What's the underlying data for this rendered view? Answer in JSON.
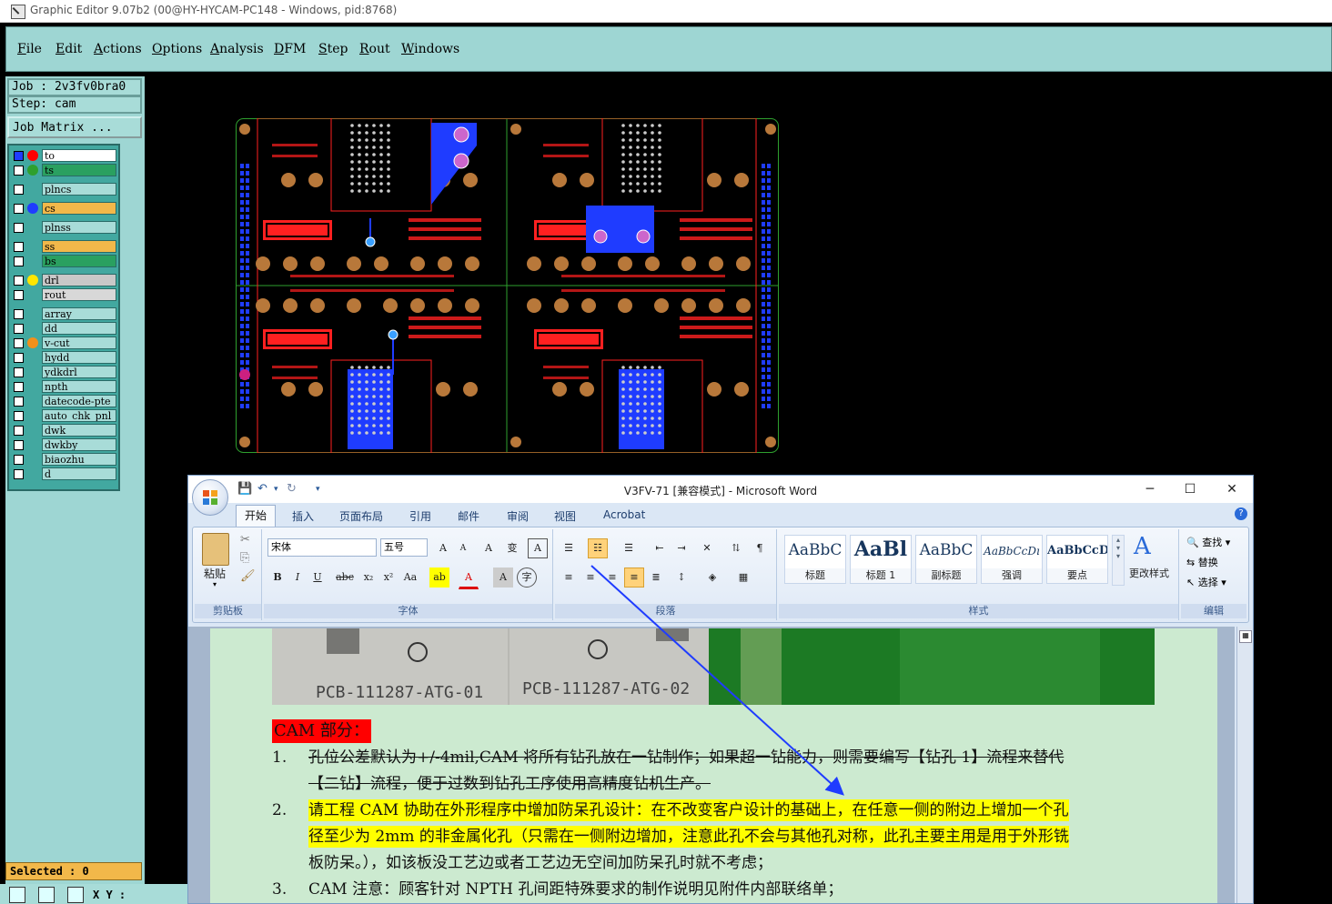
{
  "graphic_editor": {
    "title": "Graphic Editor 9.07b2 (00@HY-HYCAM-PC148 - Windows, pid:8768)",
    "menu": [
      "File",
      "Edit",
      "Actions",
      "Options",
      "Analysis",
      "DFM",
      "Step",
      "Rout",
      "Windows"
    ],
    "job_label": "Job : 2v3fv0bra0",
    "step_label": "Step: cam",
    "job_matrix_label": "Job Matrix ...",
    "layers": [
      {
        "name": "to",
        "color": "#ff0000",
        "checked": true,
        "highlight": "#ffffff"
      },
      {
        "name": "ts",
        "color": "#2ea02e",
        "checked": false,
        "highlight": "#2aa060"
      },
      {
        "name": "plncs",
        "color": "",
        "checked": false,
        "highlight": "#a8dcd8"
      },
      {
        "name": "cs",
        "color": "#1f3cff",
        "checked": false,
        "highlight": "#f2b84a"
      },
      {
        "name": "plnss",
        "color": "",
        "checked": false,
        "highlight": "#a8dcd8"
      },
      {
        "name": "ss",
        "color": "",
        "checked": false,
        "highlight": "#f2b84a"
      },
      {
        "name": "bs",
        "color": "",
        "checked": false,
        "highlight": "#2aa060"
      },
      {
        "name": "drl",
        "color": "#ffe600",
        "checked": false,
        "highlight": "#c8c8c8"
      },
      {
        "name": "rout",
        "color": "",
        "checked": false,
        "highlight": "#d8d8d8"
      },
      {
        "name": "array",
        "color": "",
        "checked": false,
        "highlight": "#a8dcd8"
      },
      {
        "name": "dd",
        "color": "",
        "checked": false,
        "highlight": "#a8dcd8"
      },
      {
        "name": "v-cut",
        "color": "#f2901a",
        "checked": false,
        "highlight": "#a8dcd8"
      },
      {
        "name": "hydd",
        "color": "",
        "checked": false,
        "highlight": "#a8dcd8"
      },
      {
        "name": "ydkdrl",
        "color": "",
        "checked": false,
        "highlight": "#a8dcd8"
      },
      {
        "name": "npth",
        "color": "",
        "checked": false,
        "highlight": "#a8dcd8"
      },
      {
        "name": "datecode-pte",
        "color": "",
        "checked": false,
        "highlight": "#a8dcd8"
      },
      {
        "name": "auto_chk_pnl",
        "color": "",
        "checked": false,
        "highlight": "#a8dcd8"
      },
      {
        "name": "dwk",
        "color": "",
        "checked": false,
        "highlight": "#a8dcd8"
      },
      {
        "name": "dwkby",
        "color": "",
        "checked": false,
        "highlight": "#a8dcd8"
      },
      {
        "name": "biaozhu",
        "color": "",
        "checked": false,
        "highlight": "#a8dcd8"
      },
      {
        "name": "d",
        "color": "",
        "checked": false,
        "highlight": "#a8dcd8"
      }
    ],
    "selected_label": "Selected : 0",
    "xy_label": "X Y :"
  },
  "word": {
    "title": "V3FV-71 [兼容模式] - Microsoft Word",
    "tabs": [
      "开始",
      "插入",
      "页面布局",
      "引用",
      "邮件",
      "审阅",
      "视图",
      "Acrobat"
    ],
    "groups": {
      "clipboard": "剪贴板",
      "font": "字体",
      "paragraph": "段落",
      "styles": "样式",
      "editing": "编辑"
    },
    "paste_label": "粘贴",
    "font_name": "宋体",
    "font_size": "五号",
    "styles": [
      {
        "preview": "AaBbC",
        "label": "标题"
      },
      {
        "preview": "AaBl",
        "label": "标题 1"
      },
      {
        "preview": "AaBbC",
        "label": "副标题"
      },
      {
        "preview": "AaBbCcDı",
        "label": "强调"
      },
      {
        "preview": "AaBbCcD",
        "label": "要点"
      }
    ],
    "change_styles_label": "更改样式",
    "editing": [
      "查找 ▾",
      "替换",
      "选择 ▾"
    ],
    "photo_labels": [
      "PCB-111287-ATG-01",
      "PCB-111287-ATG-02"
    ],
    "heading": "CAM 部分：",
    "items": [
      {
        "num": "1.",
        "lines": [
          "孔位公差默认为+/-4mil,CAM 将所有钻孔放在一钻制作；如果超一钻能力，则需要编写【钻孔 1】流程来替代",
          "【二钻】流程，便于过数到钻孔工序使用高精度钻机生产。"
        ]
      },
      {
        "num": "2.",
        "lines": [
          "请工程 CAM 协助在外形程序中增加防呆孔设计：在不改变客户设计的基础上，在任意一侧的附边上增加一个孔",
          "径至少为 2mm 的非金属化孔（只需在一侧附边增加，注意此孔不会与其他孔对称，此孔主要主用是用于外形铣",
          "板防呆。），如该板没工艺边或者工艺边无空间加防呆孔时就不考虑；"
        ]
      },
      {
        "num": "3.",
        "lines": [
          "CAM 注意：顾客针对 NPTH 孔间距特殊要求的制作说明见附件内部联络单；"
        ]
      }
    ],
    "colors": {
      "highlight": "#ffff00",
      "heading_bg": "#ff0000",
      "page_bg": "#ccead0"
    }
  }
}
